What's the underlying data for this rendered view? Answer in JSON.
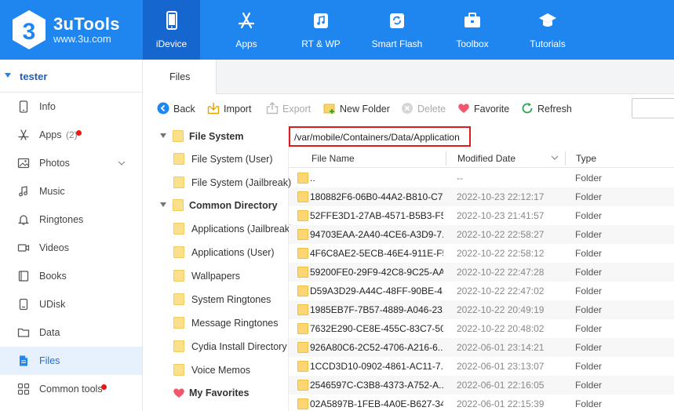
{
  "app": {
    "name": "3uTools",
    "url": "www.3u.com",
    "colors": {
      "topbar": "#1f86f0",
      "active_nav": "#1566cf",
      "accent": "#1f86f0",
      "path_border": "#e11b1b",
      "folder": "#fbd673"
    }
  },
  "nav": [
    {
      "label": "iDevice",
      "icon": "phone-icon",
      "active": true
    },
    {
      "label": "Apps",
      "icon": "app-store-icon",
      "active": false
    },
    {
      "label": "RT & WP",
      "icon": "music-note-icon",
      "active": false
    },
    {
      "label": "Smart Flash",
      "icon": "refresh-box-icon",
      "active": false
    },
    {
      "label": "Toolbox",
      "icon": "toolbox-icon",
      "active": false
    },
    {
      "label": "Tutorials",
      "icon": "graduation-cap-icon",
      "active": false
    }
  ],
  "sidebar": {
    "device_name": "tester",
    "items": [
      {
        "label": "Info",
        "icon": "phone-icon"
      },
      {
        "label": "Apps",
        "icon": "apps-icon",
        "count": "(2)",
        "badge": true
      },
      {
        "label": "Photos",
        "icon": "photo-icon",
        "expandable": true
      },
      {
        "label": "Music",
        "icon": "music-icon"
      },
      {
        "label": "Ringtones",
        "icon": "bell-icon"
      },
      {
        "label": "Videos",
        "icon": "video-icon"
      },
      {
        "label": "Books",
        "icon": "book-icon"
      },
      {
        "label": "UDisk",
        "icon": "udisk-icon"
      },
      {
        "label": "Data",
        "icon": "folder-outline-icon"
      },
      {
        "label": "Files",
        "icon": "file-icon",
        "active": true
      },
      {
        "label": "Common tools",
        "icon": "grid-icon",
        "badge": true
      }
    ]
  },
  "tabs": [
    {
      "label": "Files",
      "active": true
    }
  ],
  "toolbar": {
    "back": "Back",
    "import": "Import",
    "export": "Export",
    "new_folder": "New Folder",
    "delete": "Delete",
    "favorite": "Favorite",
    "refresh": "Refresh"
  },
  "tree": {
    "file_system": "File System",
    "file_system_user": "File System (User)",
    "file_system_jailbreak": "File System (Jailbreak)",
    "common_directory": "Common Directory",
    "common_items": [
      "Applications (Jailbreak)",
      "Applications (User)",
      "Wallpapers",
      "System Ringtones",
      "Message Ringtones",
      "Cydia Install Directory",
      "Voice Memos"
    ],
    "my_favorites": "My Favorites"
  },
  "path": "/var/mobile/Containers/Data/Application",
  "table": {
    "columns": [
      "File Name",
      "Modified Date",
      "Type"
    ],
    "rows": [
      {
        "name": "..",
        "date": "--",
        "type": "Folder"
      },
      {
        "name": "180882F6-06B0-44A2-B810-C7...",
        "date": "2022-10-23 22:12:17",
        "type": "Folder"
      },
      {
        "name": "52FFE3D1-27AB-4571-B5B3-F5...",
        "date": "2022-10-23 21:41:57",
        "type": "Folder"
      },
      {
        "name": "94703EAA-2A40-4CE6-A3D9-7...",
        "date": "2022-10-22 22:58:27",
        "type": "Folder"
      },
      {
        "name": "4F6C8AE2-5ECB-46E4-911E-F5...",
        "date": "2022-10-22 22:58:12",
        "type": "Folder"
      },
      {
        "name": "59200FE0-29F9-42C8-9C25-AA...",
        "date": "2022-10-22 22:47:28",
        "type": "Folder"
      },
      {
        "name": "D59A3D29-A44C-48FF-90BE-4...",
        "date": "2022-10-22 22:47:02",
        "type": "Folder"
      },
      {
        "name": "1985EB7F-7B57-4889-A046-23...",
        "date": "2022-10-22 20:49:19",
        "type": "Folder"
      },
      {
        "name": "7632E290-CE8E-455C-83C7-50...",
        "date": "2022-10-22 20:48:02",
        "type": "Folder"
      },
      {
        "name": "926A80C6-2C52-4706-A216-6...",
        "date": "2022-06-01 23:14:21",
        "type": "Folder"
      },
      {
        "name": "1CCD3D10-0902-4861-AC11-7...",
        "date": "2022-06-01 23:13:07",
        "type": "Folder"
      },
      {
        "name": "2546597C-C3B8-4373-A752-A...",
        "date": "2022-06-01 22:16:05",
        "type": "Folder"
      },
      {
        "name": "02A5897B-1FEB-4A0E-B627-34...",
        "date": "2022-06-01 22:15:39",
        "type": "Folder"
      }
    ]
  }
}
